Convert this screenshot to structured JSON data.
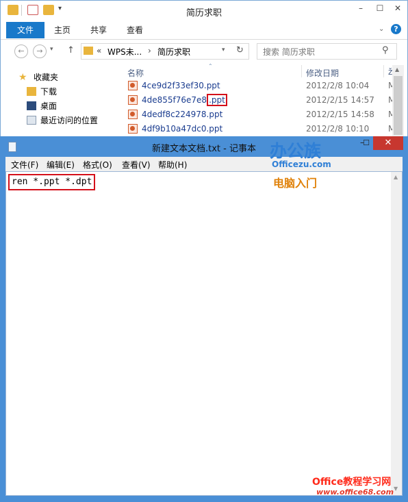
{
  "explorer": {
    "title": "简历求职",
    "ribbon_tabs": [
      "文件",
      "主页",
      "共享",
      "查看"
    ],
    "address": {
      "overflow": "«",
      "crumb1": "WPS未...",
      "sep": "›",
      "crumb2": "简历求职"
    },
    "search_placeholder": "搜索 简历求职",
    "nav_items": [
      "收藏夹",
      "下载",
      "桌面",
      "最近访问的位置"
    ],
    "columns": {
      "name": "名称",
      "date": "修改日期",
      "clip": "ž"
    },
    "files": [
      {
        "name": "4ce9d2f33ef30.ppt",
        "date": "2012/2/8 10:04",
        "clip": "M"
      },
      {
        "name_base": "4de855f76e7e8",
        "name_ext": ".ppt",
        "date": "2012/2/15 14:57",
        "clip": "M"
      },
      {
        "name": "4dedf8c224978.ppt",
        "date": "2012/2/15 14:58",
        "clip": "M"
      },
      {
        "name": "4df9b10a47dc0.ppt",
        "date": "2012/2/8 10:10",
        "clip": "M"
      }
    ]
  },
  "notepad": {
    "title": "新建文本文档.txt - 记事本",
    "menu": [
      "文件(F)",
      "编辑(E)",
      "格式(O)",
      "查看(V)",
      "帮助(H)"
    ],
    "content": "ren *.ppt *.dpt"
  },
  "watermark": {
    "logo": "办公族",
    "domain": "Officezu.com",
    "tagline": "电脑入门",
    "bottom": "Office教程学习网",
    "bottom_url": "www.office68.com"
  },
  "colors": {
    "accent": "#1979ca",
    "highlight_box": "#d4101a",
    "notepad_frame": "#4a8fd6",
    "watermark_blue": "#2f7fd6",
    "watermark_orange": "#e0820a"
  }
}
